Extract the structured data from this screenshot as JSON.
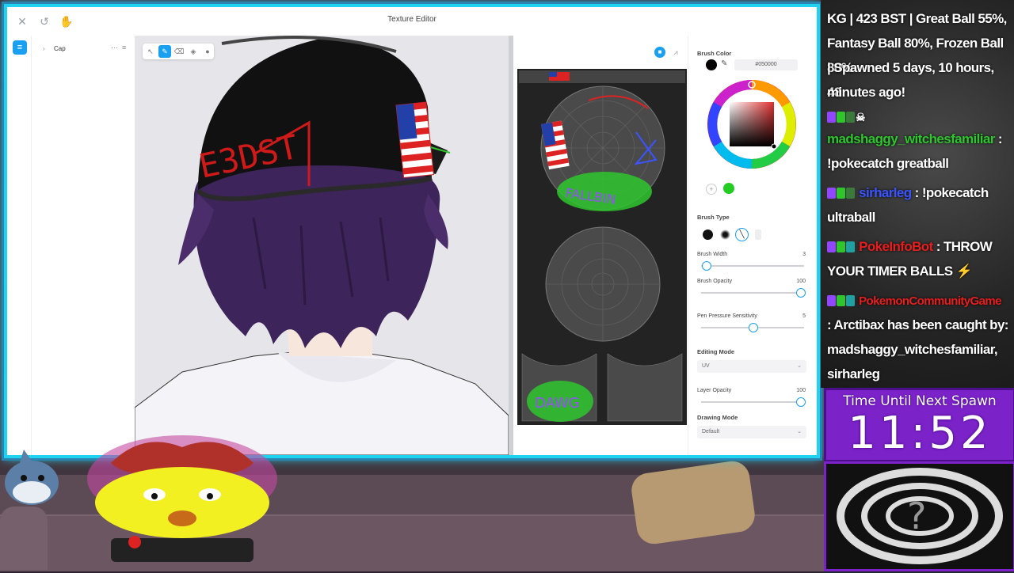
{
  "window": {
    "title": "Texture Editor"
  },
  "tree": {
    "item": "Cap"
  },
  "props": {
    "brush_color_label": "Brush Color",
    "hex_value": "#050000",
    "brush_type_label": "Brush Type",
    "brush_width_label": "Brush Width",
    "brush_width_value": "3",
    "brush_opacity_label": "Brush Opacity",
    "brush_opacity_value": "100",
    "pen_pressure_label": "Pen Pressure Sensitivity",
    "pen_pressure_value": "5",
    "editing_mode_label": "Editing Mode",
    "editing_mode_value": "UV",
    "layer_opacity_label": "Layer Opacity",
    "layer_opacity_value": "100",
    "drawing_mode_label": "Drawing Mode",
    "drawing_mode_value": "Default",
    "colors": {
      "primary": "#050000",
      "secondary": "#22cc22",
      "accent": "#1aa0f0"
    }
  },
  "chat": {
    "line1": "KG | 423 BST | Great Ball 55%,",
    "line2": "Fantasy Ball 80%, Frozen Ball 80%",
    "line3": "| Spawned 5 days, 10 hours, 48",
    "line4": "minutes ago!",
    "user1": "madshaggy_witchesfamiliar",
    "msg1a": " :",
    "msg1b": "!pokecatch greatball",
    "user2": "sirharleg",
    "msg2a": " : !pokecatch",
    "msg2b": "ultraball",
    "user3": "PokeInfoBot",
    "msg3a": " : THROW",
    "msg3b": "YOUR TIMER BALLS",
    "user4": "PokemonCommunityGame",
    "msg4a": ": Arctibax has been caught by:",
    "msg4b": "madshaggy_witchesfamiliar,",
    "msg4c": "sirharleg"
  },
  "timer": {
    "label": "Time Until Next Spawn",
    "value": "11:52"
  },
  "graffiti": {
    "cap_text": "E3DST",
    "uv_text_1": "FALLBIN",
    "uv_text_2": "DAWG"
  }
}
